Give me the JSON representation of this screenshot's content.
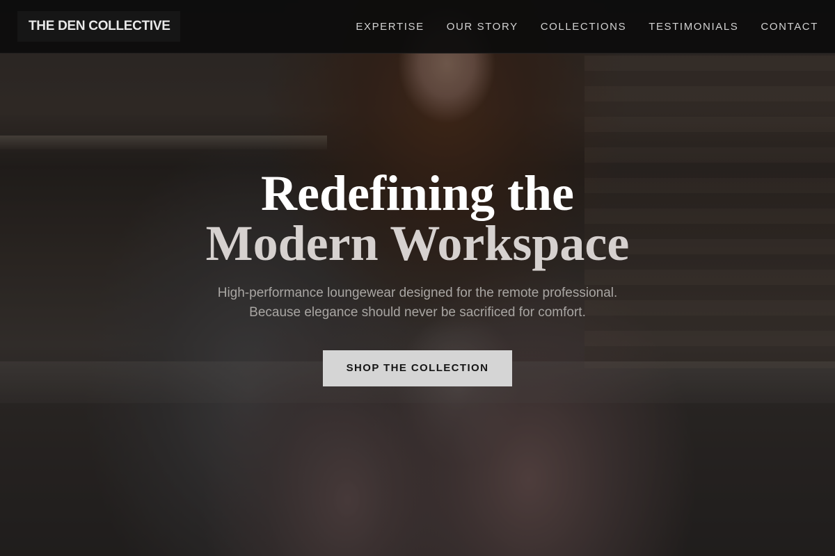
{
  "header": {
    "logo": "THE DEN COLLECTIVE",
    "nav": [
      {
        "label": "EXPERTISE"
      },
      {
        "label": "OUR STORY"
      },
      {
        "label": "COLLECTIONS"
      },
      {
        "label": "TESTIMONIALS"
      },
      {
        "label": "CONTACT"
      }
    ]
  },
  "hero": {
    "headline_line1": "Redefining the",
    "headline_line2": "Modern Workspace",
    "subtitle_line1": "High-performance loungewear designed for the remote professional.",
    "subtitle_line2": "Because elegance should never be sacrificed for comfort.",
    "cta_label": "SHOP THE COLLECTION"
  },
  "colors": {
    "header_bg": "#0c0c0c",
    "headline_primary": "#ffffff",
    "headline_secondary": "#d6d1cf",
    "cta_bg": "#d5d5d5",
    "cta_text": "#151515"
  }
}
